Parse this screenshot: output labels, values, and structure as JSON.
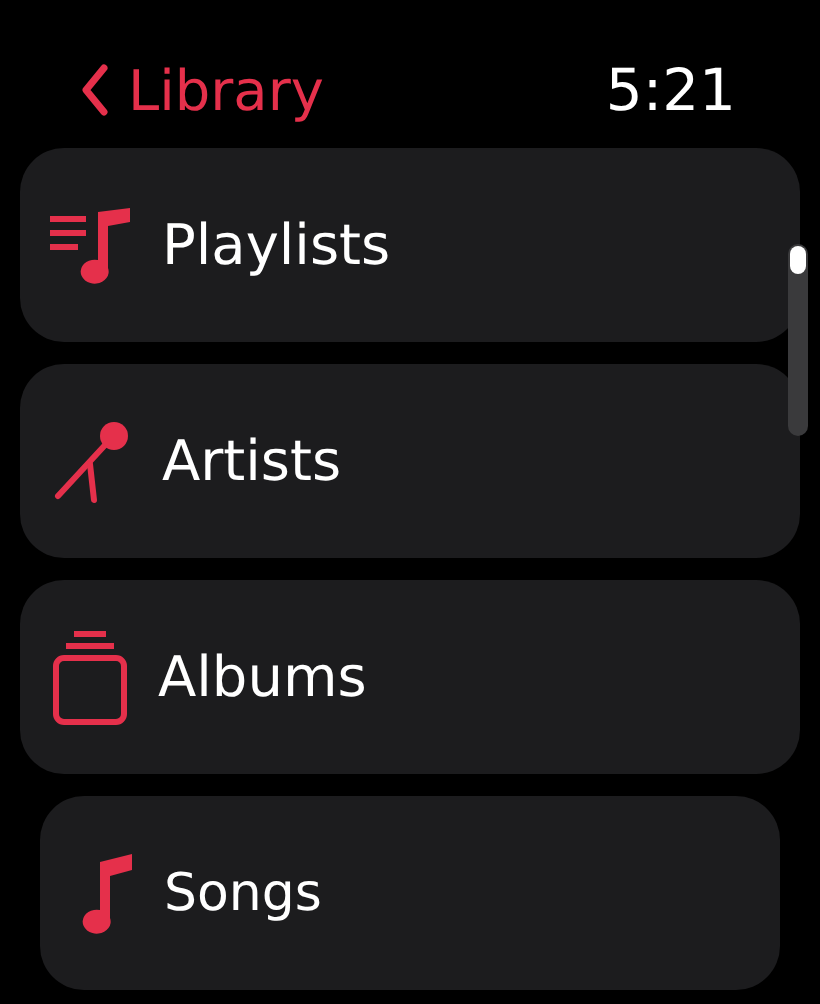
{
  "header": {
    "back_label": "Library",
    "time": "5:21"
  },
  "items": [
    {
      "label": "Playlists",
      "kind": "playlists"
    },
    {
      "label": "Artists",
      "kind": "artists"
    },
    {
      "label": "Albums",
      "kind": "albums"
    },
    {
      "label": "Songs",
      "kind": "songs"
    }
  ]
}
